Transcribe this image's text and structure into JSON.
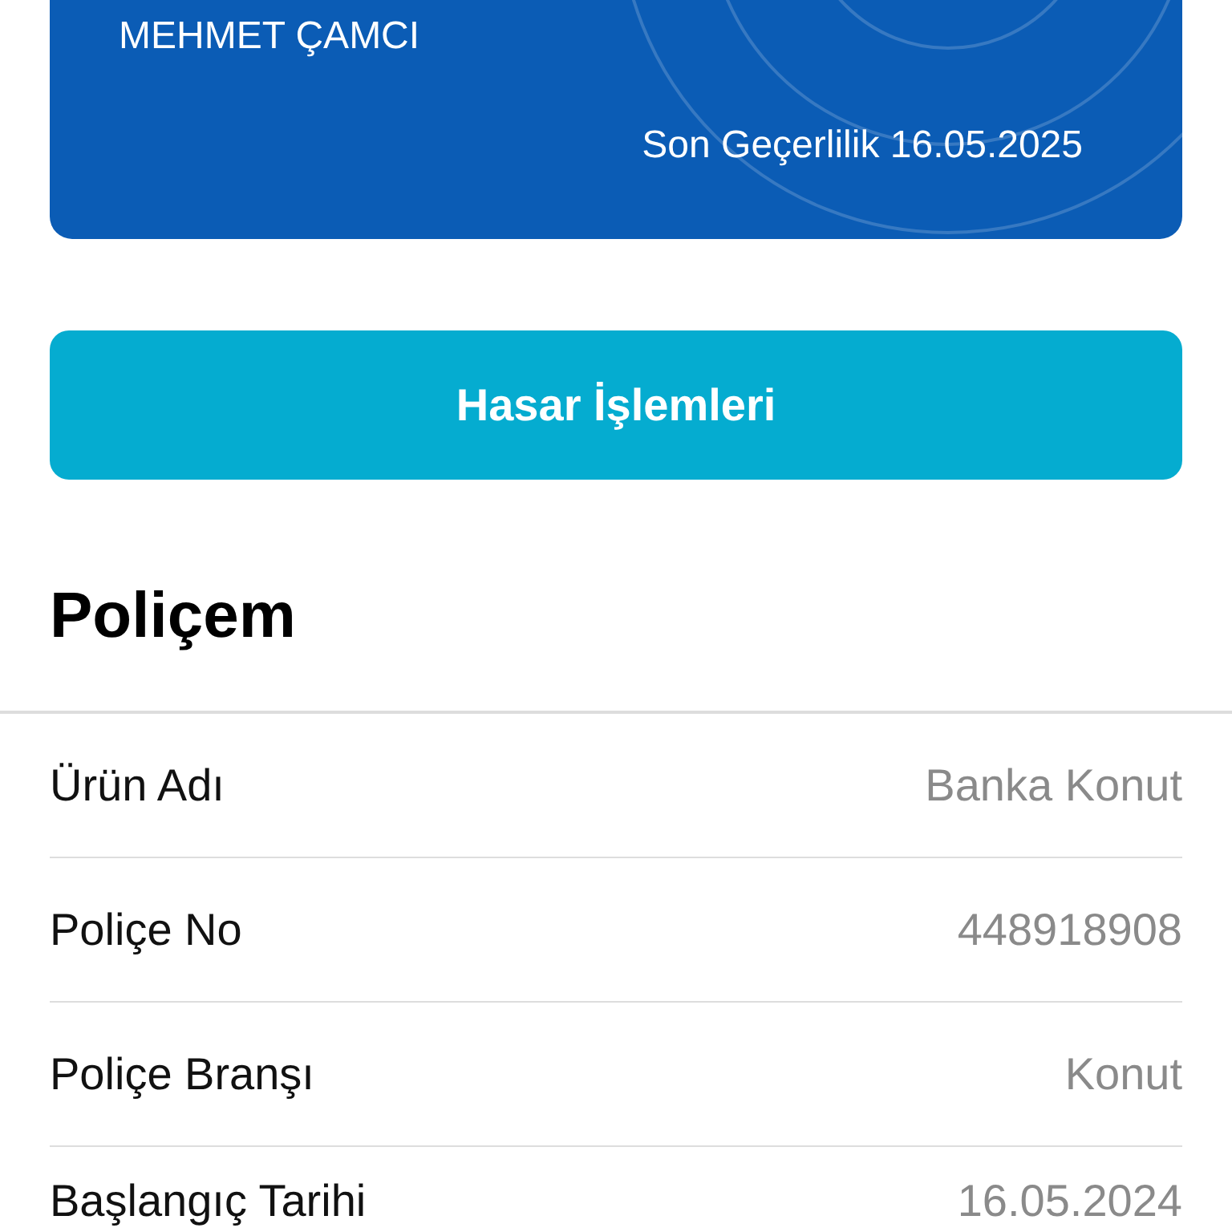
{
  "card": {
    "holder": "MEHMET ÇAMCI",
    "expiry": "Son Geçerlilik 16.05.2025"
  },
  "action_button": {
    "label": "Hasar İşlemleri"
  },
  "section": {
    "title": "Poliçem"
  },
  "details": [
    {
      "label": "Ürün Adı",
      "value": "Banka Konut"
    },
    {
      "label": "Poliçe No",
      "value": "448918908"
    },
    {
      "label": "Poliçe Branşı",
      "value": "Konut"
    },
    {
      "label": "Başlangıç Tarihi",
      "value": "16.05.2024"
    }
  ]
}
